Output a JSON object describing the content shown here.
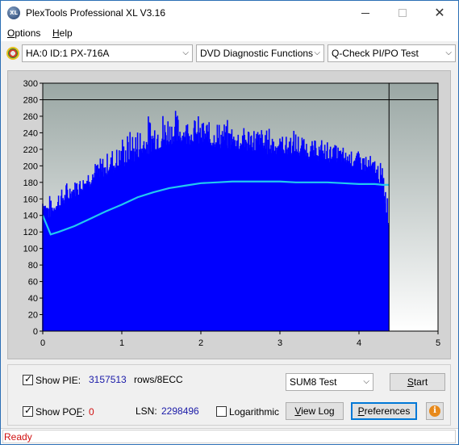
{
  "window": {
    "title": "PlexTools Professional XL V3.16",
    "app_icon_text": "XL",
    "minimize_glyph": "",
    "close_glyph": "✕"
  },
  "menu": {
    "items": [
      {
        "accel": "O",
        "rest": "ptions"
      },
      {
        "accel": "H",
        "rest": "elp"
      }
    ]
  },
  "toolbar": {
    "drive": "HA:0 ID:1  PX-716A",
    "function": "DVD Diagnostic Functions",
    "test": "Q-Check PI/PO Test",
    "chevron": "⌵"
  },
  "chart_data": {
    "type": "area",
    "title": "",
    "xlabel": "",
    "ylabel": "",
    "xlim": [
      0,
      5
    ],
    "ylim": [
      0,
      300
    ],
    "x_ticks": [
      "0",
      "1",
      "2",
      "3",
      "4",
      "5"
    ],
    "y_ticks": [
      "0",
      "20",
      "40",
      "60",
      "80",
      "100",
      "120",
      "140",
      "160",
      "180",
      "200",
      "220",
      "240",
      "260",
      "280",
      "300"
    ],
    "threshold_line": 280,
    "data_end_x": 4.38,
    "grid": false,
    "colors": {
      "pie": "#0000ff",
      "sum8": "#22c8f0",
      "plot_bg_top": "#9aa7a4",
      "plot_bg_bottom": "#ffffff"
    },
    "series": [
      {
        "name": "PIE",
        "x": [
          0,
          0.1,
          0.2,
          0.4,
          0.6,
          0.8,
          1.0,
          1.2,
          1.4,
          1.6,
          1.8,
          2.0,
          2.2,
          2.4,
          2.6,
          2.8,
          3.0,
          3.2,
          3.4,
          3.6,
          3.8,
          4.0,
          4.2,
          4.3,
          4.38
        ],
        "values": [
          150,
          138,
          150,
          165,
          178,
          190,
          200,
          210,
          220,
          226,
          230,
          228,
          225,
          222,
          220,
          218,
          216,
          214,
          210,
          208,
          205,
          200,
          190,
          175,
          120
        ],
        "peaks": [
          165,
          162,
          172,
          185,
          200,
          215,
          235,
          250,
          265,
          270,
          262,
          258,
          255,
          252,
          250,
          248,
          240,
          242,
          232,
          230,
          222,
          218,
          210,
          200,
          160
        ]
      },
      {
        "name": "SUM8",
        "x": [
          0,
          0.1,
          0.2,
          0.4,
          0.6,
          0.8,
          1.0,
          1.2,
          1.4,
          1.6,
          1.8,
          2.0,
          2.2,
          2.4,
          2.6,
          2.8,
          3.0,
          3.2,
          3.4,
          3.6,
          3.8,
          4.0,
          4.2,
          4.3,
          4.38
        ],
        "values": [
          140,
          117,
          120,
          127,
          136,
          145,
          153,
          162,
          168,
          173,
          176,
          179,
          180,
          181,
          181,
          181,
          181,
          180,
          180,
          180,
          179,
          178,
          178,
          177,
          177
        ]
      }
    ]
  },
  "bottom": {
    "show_pie_label": "Show PIE:",
    "pie_value": "3157513",
    "pie_unit": "rows/8ECC",
    "show_pof_label_pre": "Show PO",
    "show_pof_label_accel": "F",
    "show_pof_label_post": ":",
    "pof_value": "0",
    "lsn_label": "LSN:",
    "lsn_value": "2298496",
    "logarithmic_label": "Logarithmic",
    "test_select": "SUM8 Test",
    "start_accel": "S",
    "start_rest": "tart",
    "view_log_accel": "V",
    "view_log_rest": "iew Log",
    "preferences_accel": "P",
    "preferences_rest": "references",
    "info_glyph": "i",
    "check_glyph": "✓"
  },
  "status": {
    "text": "Ready"
  }
}
